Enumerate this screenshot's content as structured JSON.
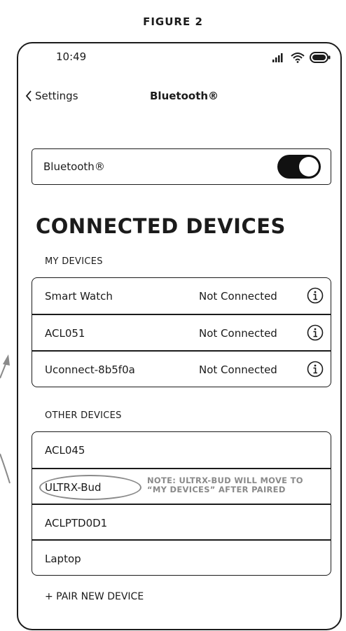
{
  "figure_title": "FIGURE 2",
  "status_bar": {
    "time": "10:49"
  },
  "nav": {
    "back_label": "Settings",
    "title": "Bluetooth®"
  },
  "bluetooth_toggle": {
    "label": "Bluetooth®",
    "state": "on"
  },
  "section_title": "CONNECTED DEVICES",
  "my_devices": {
    "header": "MY DEVICES",
    "items": [
      {
        "name": "Smart Watch",
        "status": "Not Connected"
      },
      {
        "name": "ACL051",
        "status": "Not Connected"
      },
      {
        "name": "Uconnect-8b5f0a",
        "status": "Not Connected"
      }
    ]
  },
  "other_devices": {
    "header": "OTHER DEVICES",
    "items": [
      {
        "name": "ACL045"
      },
      {
        "name": "ULTRX-Bud",
        "note_line1": "NOTE: ULTRX-BUD WILL MOVE TO",
        "note_line2": "“MY DEVICES” AFTER PAIRED"
      },
      {
        "name": "ACLPTD0D1"
      },
      {
        "name": "Laptop"
      }
    ]
  },
  "pair_new": "+ PAIR NEW DEVICE",
  "colors": {
    "ink": "#1b1b1b",
    "note_gray": "#8a8a8a",
    "toggle_on": "#111111"
  }
}
